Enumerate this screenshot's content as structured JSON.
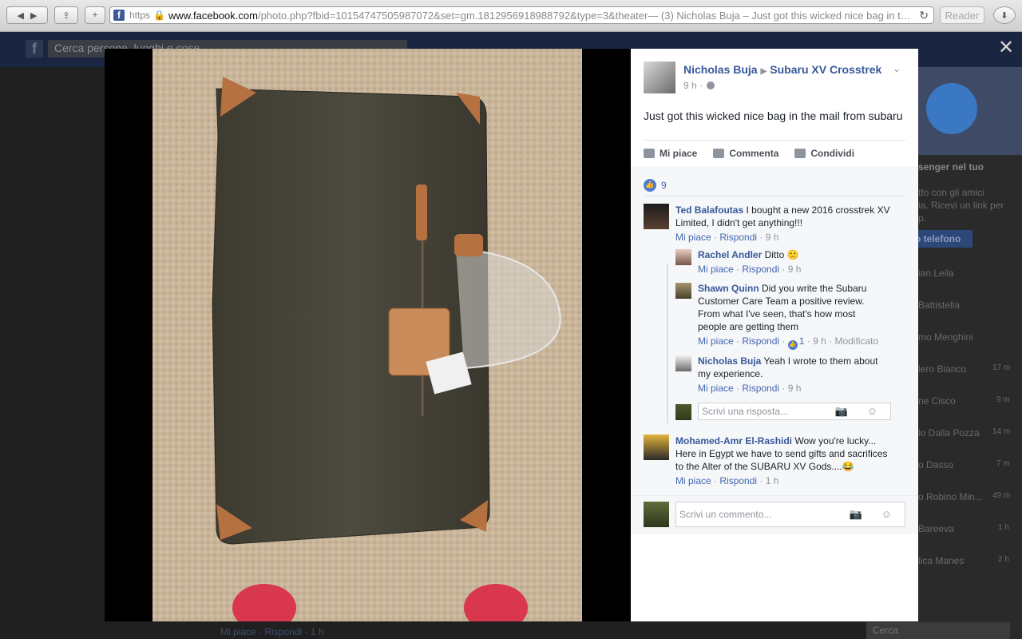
{
  "browser": {
    "url_scheme": "https",
    "url_host": "www.facebook.com",
    "url_rest": "/photo.php?fbid=10154747505987072&set=gm.1812956918988792&type=3&theater",
    "page_title": " — (3) Nicholas Buja – Just got this wicked nice bag in t…",
    "reader_label": "Reader",
    "back_icon": "◀",
    "forward_icon": "▶",
    "share_icon": "⇪",
    "add_icon": "+",
    "reload_icon": "↻",
    "download_icon": "⬇"
  },
  "background": {
    "search_placeholder": "Cerca persone, luoghi e cose",
    "messenger_title": "senger nel tuo",
    "messenger_text_1": "tto con gli amici",
    "messenger_text_2": "ia. Ricevi un link per",
    "messenger_text_3": "p.",
    "phone_button": "o telefono",
    "contacts": [
      {
        "name": "ian Leila",
        "time": ""
      },
      {
        "name": "Battistella",
        "time": ""
      },
      {
        "name": "mo Menghini",
        "time": ""
      },
      {
        "name": "lero Bianco",
        "time": "17 m"
      },
      {
        "name": "ne Cisco",
        "time": "9 m"
      },
      {
        "name": "lo Dalla Pozza",
        "time": "14 m"
      },
      {
        "name": "o Dasso",
        "time": "7 m"
      },
      {
        "name": "o Robino Min...",
        "time": "49 m"
      },
      {
        "name": "Bareeva",
        "time": "1 h"
      },
      {
        "name": "lica Manes",
        "time": "2 h"
      }
    ],
    "bottom_search": "Cerca",
    "bottom_left_1": "Mi piace · Rispondi · 1 h"
  },
  "viewer": {
    "close_icon": "✕"
  },
  "post": {
    "author": "Nicholas Buja",
    "group": "Subaru XV Crosstrek",
    "time": "9 h ·",
    "text": "Just got this wicked nice bag in the mail from subaru",
    "actions": {
      "like": "Mi piace",
      "comment": "Commenta",
      "share": "Condividi"
    },
    "like_count": "9"
  },
  "comments": [
    {
      "author": "Ted Balafoutas",
      "text": "I bought a new 2016 crosstrek XV Limited, I didn't get anything!!!",
      "like": "Mi piace",
      "reply": "Rispondi",
      "time": "9 h"
    },
    {
      "author": "Rachel Andler",
      "text": "Ditto 🙁",
      "like": "Mi piace",
      "reply": "Rispondi",
      "time": "9 h"
    },
    {
      "author": "Shawn Quinn",
      "text": "Did you write the Subaru Customer Care Team a positive review. From what I've seen, that's how most people are getting them",
      "like": "Mi piace",
      "reply": "Rispondi",
      "likes": "1",
      "time": "9 h",
      "edited": "Modificato"
    },
    {
      "author": "Nicholas Buja",
      "text": "Yeah I wrote to them about my experience.",
      "like": "Mi piace",
      "reply": "Rispondi",
      "time": "9 h"
    },
    {
      "author": "Mohamed-Amr El-Rashidi",
      "text": "Wow you're lucky... Here in Egypt we have to send gifts and sacrifices to the Alter of the SUBARU XV Gods....😂",
      "like": "Mi piace",
      "reply": "Rispondi",
      "time": "1 h"
    }
  ],
  "reply_input": {
    "placeholder": "Scrivi una risposta..."
  },
  "comment_input": {
    "placeholder": "Scrivi un commento..."
  },
  "input_icons": "📷 ☺"
}
